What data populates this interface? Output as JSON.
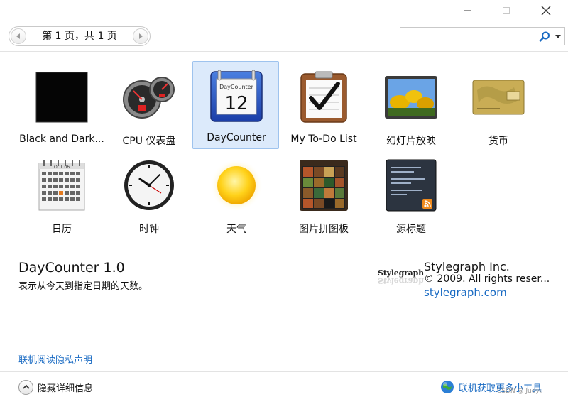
{
  "window": {
    "controls": {
      "minimize": "minimize-icon",
      "maximize": "maximize-icon",
      "close": "close-icon"
    }
  },
  "toolbar": {
    "page_label": "第 1 页，共 1 页",
    "search_value": "",
    "search_placeholder": ""
  },
  "gadgets": [
    {
      "label": "Black and Dark...",
      "icon": "black-square-icon",
      "selected": false
    },
    {
      "label": "CPU 仪表盘",
      "icon": "cpu-gauge-icon",
      "selected": false
    },
    {
      "label": "DayCounter",
      "icon": "daycounter-calendar-icon",
      "selected": true,
      "thumb_month": "DayCounter",
      "thumb_day": "12"
    },
    {
      "label": "My To-Do List",
      "icon": "todo-clipboard-icon",
      "selected": false
    },
    {
      "label": "幻灯片放映",
      "icon": "slideshow-icon",
      "selected": false
    },
    {
      "label": "货币",
      "icon": "currency-card-icon",
      "selected": false
    },
    {
      "label": "日历",
      "icon": "calendar-icon",
      "selected": false,
      "thumb_month": "OCT 06"
    },
    {
      "label": "时钟",
      "icon": "clock-icon",
      "selected": false
    },
    {
      "label": "天气",
      "icon": "weather-sun-icon",
      "selected": false
    },
    {
      "label": "图片拼图板",
      "icon": "picture-puzzle-icon",
      "selected": false
    },
    {
      "label": "源标题",
      "icon": "feed-headlines-icon",
      "selected": false
    }
  ],
  "details": {
    "title": "DayCounter 1.0",
    "description": "表示从今天到指定日期的天数。",
    "logo_text": "Stylegraph",
    "publisher": "Stylegraph Inc.",
    "copyright": "© 2009. All rights reser...",
    "url": "stylegraph.com",
    "privacy_link": "联机阅读隐私声明"
  },
  "footer": {
    "hide_details": "隐藏详细信息",
    "get_more": "联机获取更多小工具",
    "watermark": "CSDN @ Judy\\"
  },
  "colors": {
    "link": "#1a6bc3",
    "selected_bg": "#dceafb",
    "selected_border": "#9ec3ee"
  }
}
